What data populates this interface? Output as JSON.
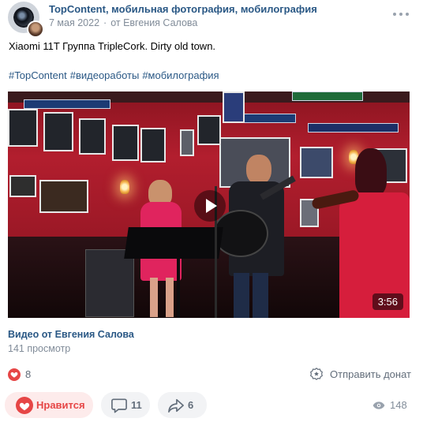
{
  "header": {
    "group_name": "TopContent, мобильная фотография, мобилография",
    "date": "7 мая 2022",
    "author": "от Евгения Салова"
  },
  "post": {
    "text": "Xiaomi 11T Группа TripleCork. Dirty old town.",
    "hashtags": [
      "#TopContent",
      "#видеоработы",
      "#мобилография"
    ]
  },
  "video": {
    "duration": "3:56",
    "title": "Видео от Евгения Салова",
    "views": "141 просмотр"
  },
  "reactions": {
    "likes_count": "8",
    "donate_label": "Отправить донат"
  },
  "actions": {
    "like_label": "Нравится",
    "comments_count": "11",
    "shares_count": "6",
    "views_count": "148"
  },
  "colors": {
    "link": "#2a5885",
    "muted": "#818c99",
    "like_red": "#e64646",
    "button_bg": "#f2f3f5"
  },
  "icons": [
    "avatar-camera-lens",
    "more-dots-icon",
    "play-icon",
    "heart-icon",
    "donate-icon",
    "comment-icon",
    "share-icon",
    "eye-icon"
  ]
}
